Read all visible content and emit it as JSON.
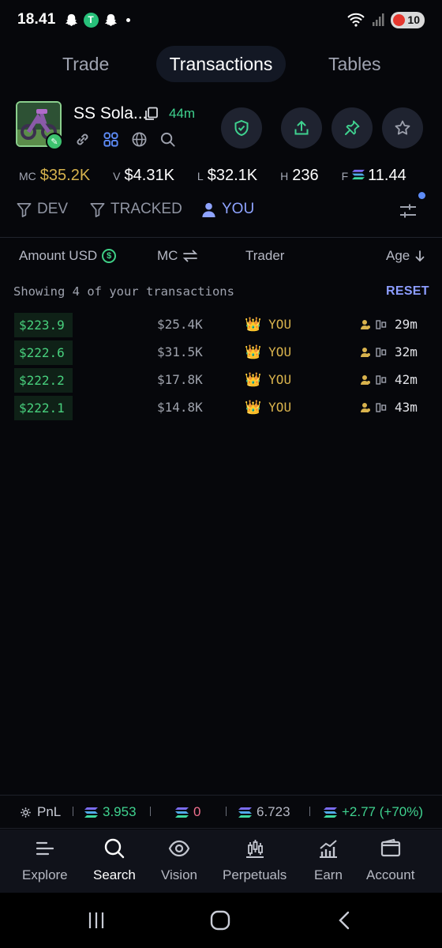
{
  "status_bar": {
    "time": "18.41",
    "app_icon_letter": "T",
    "battery": "10"
  },
  "tabs": [
    {
      "label": "Trade",
      "active": false
    },
    {
      "label": "Transactions",
      "active": true
    },
    {
      "label": "Tables",
      "active": false
    }
  ],
  "token": {
    "name": "SS Sola...",
    "age": "44m"
  },
  "stats": [
    {
      "key": "MC",
      "value": "$35.2K"
    },
    {
      "key": "V",
      "value": "$4.31K"
    },
    {
      "key": "L",
      "value": "$32.1K"
    },
    {
      "key": "H",
      "value": "236"
    },
    {
      "key": "F",
      "value": "11.44"
    }
  ],
  "filters": [
    {
      "label": "DEV",
      "active": false
    },
    {
      "label": "TRACKED",
      "active": false
    },
    {
      "label": "YOU",
      "active": true
    }
  ],
  "table": {
    "headers": {
      "amount": "Amount USD",
      "mc": "MC",
      "trader": "Trader",
      "age": "Age"
    },
    "showing_text": "Showing 4 of your transactions",
    "reset_label": "RESET",
    "rows": [
      {
        "amount": "$223.9",
        "mc": "$25.4K",
        "trader": "YOU",
        "age": "29m"
      },
      {
        "amount": "$222.6",
        "mc": "$31.5K",
        "trader": "YOU",
        "age": "32m"
      },
      {
        "amount": "$222.2",
        "mc": "$17.8K",
        "trader": "YOU",
        "age": "42m"
      },
      {
        "amount": "$222.1",
        "mc": "$14.8K",
        "trader": "YOU",
        "age": "43m"
      }
    ]
  },
  "pnl": {
    "label": "PnL",
    "bought": "3.953",
    "sold": "0",
    "holding": "6.723",
    "profit": "+2.77 (+70%)"
  },
  "nav": [
    {
      "label": "Explore"
    },
    {
      "label": "Search"
    },
    {
      "label": "Vision"
    },
    {
      "label": "Perpetuals"
    },
    {
      "label": "Earn"
    },
    {
      "label": "Account"
    }
  ],
  "colors": {
    "background": "#06070b",
    "accent_green": "#3fd28f",
    "accent_gold": "#d6b24d",
    "accent_blue": "#8ea3ff",
    "loss_red": "#f0708e"
  }
}
